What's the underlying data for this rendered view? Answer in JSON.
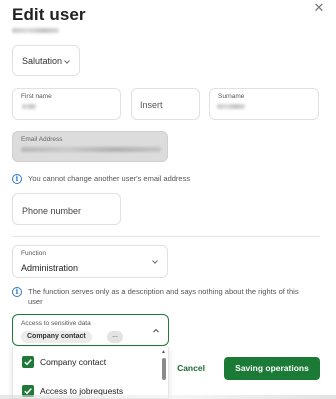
{
  "dialog": {
    "title": "Edit user",
    "close_icon": "close-icon"
  },
  "salutation": {
    "placeholder": "Salutation"
  },
  "first_name": {
    "label": "First name"
  },
  "insert": {
    "placeholder": "Insert"
  },
  "surname": {
    "label": "Surname"
  },
  "email": {
    "label": "Email Address",
    "info": "You cannot change another user's email address"
  },
  "phone": {
    "placeholder": "Phone number"
  },
  "function": {
    "label": "Function",
    "value": "Administration",
    "info": "The function serves only as a description and says nothing about the rights of this user"
  },
  "access": {
    "label": "Access to sensitive data",
    "chip": "Company contact",
    "more": "..."
  },
  "access_options": [
    {
      "label": "Company contact",
      "checked": true
    },
    {
      "label": "Access to jobrequests",
      "checked": true
    }
  ],
  "buttons": {
    "cancel": "Cancel",
    "save": "Saving operations"
  },
  "colors": {
    "primary_green": "#1c7a37",
    "info_blue": "#2d79c7"
  }
}
